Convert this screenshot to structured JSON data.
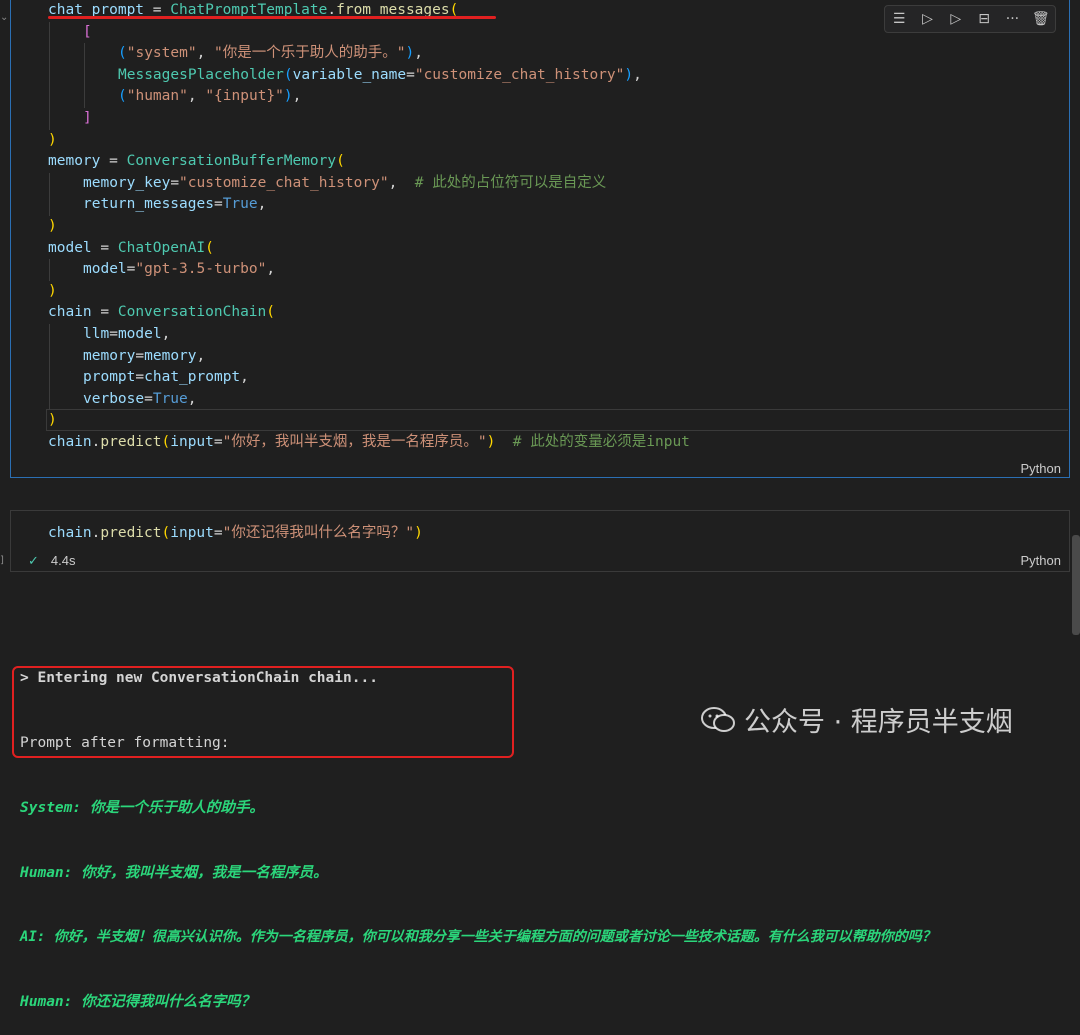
{
  "cell1": {
    "lines": [
      {
        "t": [
          [
            "chat_prompt",
            "v"
          ],
          [
            " = ",
            ""
          ],
          [
            "ChatPromptTemplate",
            "f"
          ],
          [
            ".",
            ""
          ],
          [
            "from_messages",
            "fn"
          ],
          [
            "(",
            "p1"
          ]
        ]
      },
      {
        "i": 1,
        "t": [
          [
            "[",
            "p2"
          ]
        ]
      },
      {
        "i": 2,
        "t": [
          [
            "(",
            "p3"
          ],
          [
            "\"system\"",
            "s"
          ],
          [
            ", ",
            ""
          ],
          [
            "\"你是一个乐于助人的助手。\"",
            "s"
          ],
          [
            ")",
            "p3"
          ],
          [
            ",",
            ""
          ]
        ]
      },
      {
        "i": 2,
        "t": [
          [
            "MessagesPlaceholder",
            "f"
          ],
          [
            "(",
            "p3"
          ],
          [
            "variable_name",
            "v"
          ],
          [
            "=",
            ""
          ],
          [
            "\"customize_chat_history\"",
            "s"
          ],
          [
            ")",
            "p3"
          ],
          [
            ",",
            ""
          ]
        ]
      },
      {
        "i": 2,
        "t": [
          [
            "(",
            "p3"
          ],
          [
            "\"human\"",
            "s"
          ],
          [
            ", ",
            ""
          ],
          [
            "\"{input}\"",
            "s"
          ],
          [
            ")",
            "p3"
          ],
          [
            ",",
            ""
          ]
        ]
      },
      {
        "i": 1,
        "t": [
          [
            "]",
            "p2"
          ]
        ]
      },
      {
        "t": [
          [
            ")",
            "p1"
          ]
        ]
      },
      {
        "t": [
          [
            "memory",
            "v"
          ],
          [
            " = ",
            ""
          ],
          [
            "ConversationBufferMemory",
            "f"
          ],
          [
            "(",
            "p1"
          ]
        ]
      },
      {
        "i": 1,
        "t": [
          [
            "memory_key",
            "v"
          ],
          [
            "=",
            ""
          ],
          [
            "\"customize_chat_history\"",
            "s"
          ],
          [
            ",  ",
            ""
          ],
          [
            "# 此处的占位符可以是自定义",
            "c"
          ]
        ]
      },
      {
        "i": 1,
        "t": [
          [
            "return_messages",
            "v"
          ],
          [
            "=",
            ""
          ],
          [
            "True",
            "k"
          ],
          [
            ",",
            ""
          ]
        ]
      },
      {
        "t": [
          [
            ")",
            "p1"
          ]
        ]
      },
      {
        "t": [
          [
            "model",
            "v"
          ],
          [
            " = ",
            ""
          ],
          [
            "ChatOpenAI",
            "f"
          ],
          [
            "(",
            "p1"
          ]
        ]
      },
      {
        "i": 1,
        "t": [
          [
            "model",
            "v"
          ],
          [
            "=",
            ""
          ],
          [
            "\"gpt-3.5-turbo\"",
            "s"
          ],
          [
            ",",
            ""
          ]
        ]
      },
      {
        "t": [
          [
            ")",
            "p1"
          ]
        ]
      },
      {
        "t": [
          [
            "chain",
            "v"
          ],
          [
            " = ",
            ""
          ],
          [
            "ConversationChain",
            "f"
          ],
          [
            "(",
            "p1"
          ]
        ]
      },
      {
        "i": 1,
        "t": [
          [
            "llm",
            "v"
          ],
          [
            "=",
            ""
          ],
          [
            "model",
            "v"
          ],
          [
            ",",
            ""
          ]
        ]
      },
      {
        "i": 1,
        "t": [
          [
            "memory",
            "v"
          ],
          [
            "=",
            ""
          ],
          [
            "memory",
            "v"
          ],
          [
            ",",
            ""
          ]
        ]
      },
      {
        "i": 1,
        "t": [
          [
            "prompt",
            "v"
          ],
          [
            "=",
            ""
          ],
          [
            "chat_prompt",
            "v"
          ],
          [
            ",",
            ""
          ]
        ]
      },
      {
        "i": 1,
        "t": [
          [
            "verbose",
            "v"
          ],
          [
            "=",
            ""
          ],
          [
            "True",
            "k"
          ],
          [
            ",",
            ""
          ]
        ]
      },
      {
        "t": [
          [
            ")",
            "p1"
          ]
        ]
      },
      {
        "t": [
          [
            "chain",
            "v"
          ],
          [
            ".",
            ""
          ],
          [
            "predict",
            "fn"
          ],
          [
            "(",
            "p1"
          ],
          [
            "input",
            "v"
          ],
          [
            "=",
            ""
          ],
          [
            "\"你好，我叫半支烟，我是一名程序员。\"",
            "s"
          ],
          [
            ")",
            "p1"
          ],
          [
            "  ",
            ""
          ],
          [
            "# 此处的变量必须是input",
            "c"
          ]
        ]
      }
    ],
    "language": "Python"
  },
  "cell2": {
    "lines": [
      {
        "t": [
          [
            "chain",
            "v"
          ],
          [
            ".",
            ""
          ],
          [
            "predict",
            "fn"
          ],
          [
            "(",
            "p1"
          ],
          [
            "input",
            "v"
          ],
          [
            "=",
            ""
          ],
          [
            "\"你还记得我叫什么名字吗？\"",
            "s"
          ],
          [
            ")",
            "p1"
          ]
        ]
      }
    ],
    "status_time": "4.4s",
    "language": "Python"
  },
  "output": {
    "line1": "> Entering new ConversationChain chain...",
    "line2": "Prompt after formatting:",
    "green": [
      "System: 你是一个乐于助人的助手。",
      "Human: 你好，我叫半支烟，我是一名程序员。",
      "AI: 你好，半支烟！很高兴认识你。作为一名程序员，你可以和我分享一些关于编程方面的问题或者讨论一些技术话题。有什么我可以帮助你的吗？",
      "Human: 你还记得我叫什么名字吗？"
    ]
  },
  "watermark": "公众号 · 程序员半支烟",
  "colors": {
    "annotation_red": "#e02020",
    "cell_border_active": "#2b6fb3",
    "output_green": "#2bd67b"
  }
}
